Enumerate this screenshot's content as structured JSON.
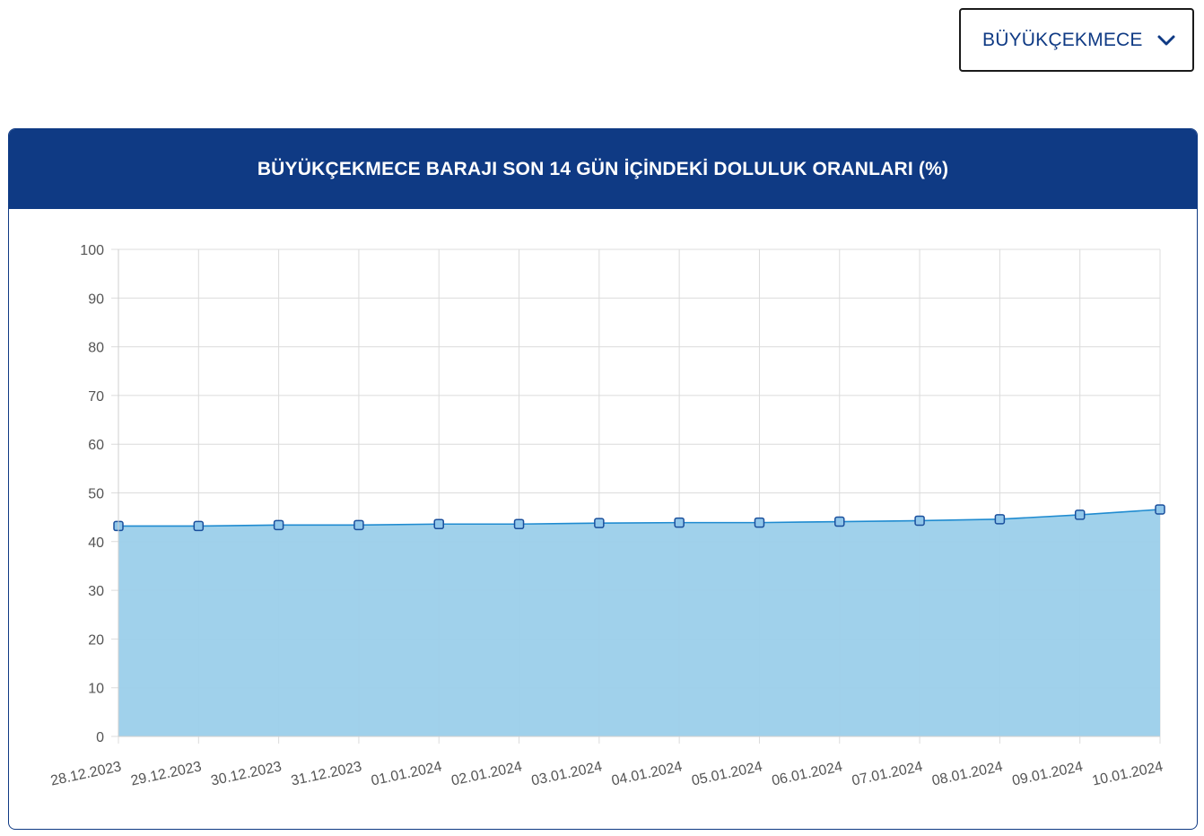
{
  "dam_selector": {
    "selected": "BÜYÜKÇEKMECE",
    "icon": "chevron-down-icon"
  },
  "colors": {
    "header_bg": "#0f3a84",
    "area_fill": "#9bcfea",
    "line": "#1f8bd0",
    "marker_fill": "#8fc6ea",
    "marker_stroke": "#1a4f9c",
    "grid": "#dcdcdc",
    "tick_text": "#555555"
  },
  "chart_data": {
    "type": "area",
    "title": "BÜYÜKÇEKMECE BARAJI SON 14 GÜN İÇİNDEKİ DOLULUK ORANLARI (%)",
    "xlabel": "",
    "ylabel": "",
    "ylim": [
      0,
      100
    ],
    "yticks": [
      0,
      10,
      20,
      30,
      40,
      50,
      60,
      70,
      80,
      90,
      100
    ],
    "grid": true,
    "categories": [
      "28.12.2023",
      "29.12.2023",
      "30.12.2023",
      "31.12.2023",
      "01.01.2024",
      "02.01.2024",
      "03.01.2024",
      "04.01.2024",
      "05.01.2024",
      "06.01.2024",
      "07.01.2024",
      "08.01.2024",
      "09.01.2024",
      "10.01.2024"
    ],
    "series": [
      {
        "values": [
          43.2,
          43.2,
          43.4,
          43.4,
          43.6,
          43.6,
          43.8,
          43.9,
          43.9,
          44.1,
          44.3,
          44.6,
          45.5,
          46.6
        ]
      }
    ]
  }
}
